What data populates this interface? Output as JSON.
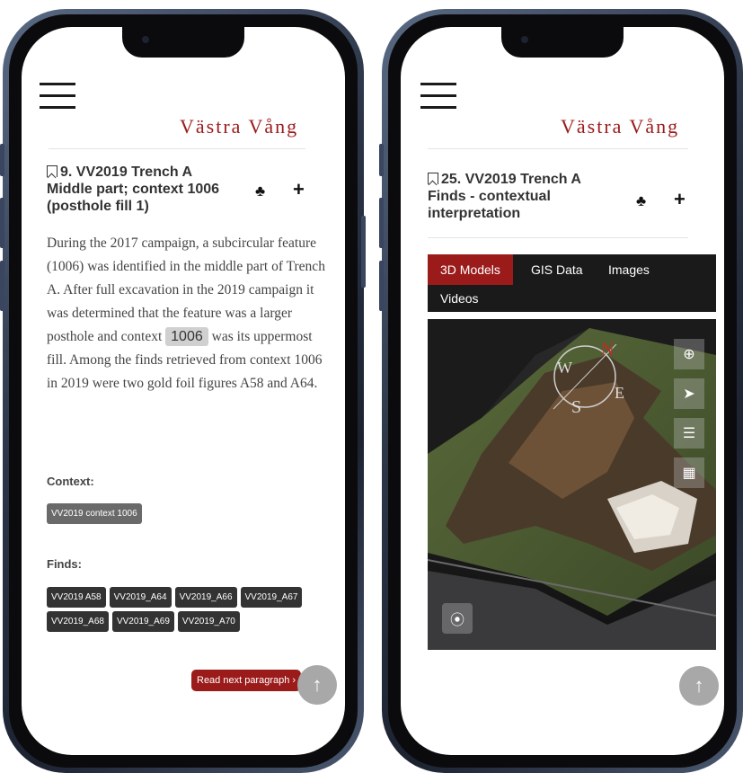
{
  "left": {
    "brand": "Västra Vång",
    "title": "9. VV2019 Trench A Middle part; context 1006 (posthole fill 1)",
    "paragraph": {
      "before": "During the 2017 campaign, a subcircular feature (1006) was identified in the middle part of Trench A. After full excavation in the 2019 campaign it was determined that the feature was a larger posthole and context",
      "highlight": "1006",
      "after": "was its uppermost fill. Among the finds retrieved from context 1006 in 2019 were two gold foil figures A58 and A64."
    },
    "context_label": "Context:",
    "context_tags": [
      "VV2019 context 1006"
    ],
    "finds_label": "Finds:",
    "finds_tags": [
      "VV2019 A58",
      "VV2019_A64",
      "VV2019_A66",
      "VV2019_A67",
      "VV2019_A68",
      "VV2019_A69",
      "VV2019_A70"
    ],
    "read_next": "Read next paragraph ›",
    "up_arrow": "↑"
  },
  "right": {
    "brand": "Västra Vång",
    "title": "25. VV2019 Trench A Finds - contextual interpretation",
    "tabs": [
      "3D Models",
      "GIS Data",
      "Images",
      "Videos"
    ],
    "active_tab": "3D Models",
    "compass_letters": [
      "N",
      "E",
      "S",
      "W"
    ],
    "up_arrow": "↑"
  },
  "icons": {
    "menu": "hamburger-icon",
    "bookmark": "bookmark-icon",
    "cluster": "3d-cubes-icon",
    "add": "plus-icon",
    "up": "arrow-up-icon"
  },
  "colors": {
    "accent": "#9b1b1b",
    "tag": "#333333",
    "tabbar": "#1a1a1a"
  }
}
